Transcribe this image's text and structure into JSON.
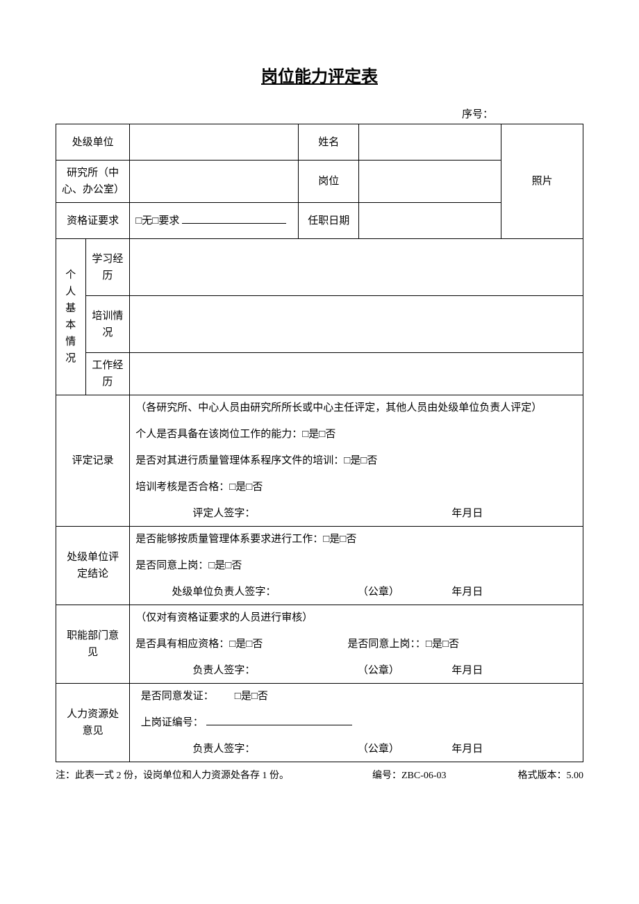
{
  "title": "岗位能力评定表",
  "seq_label": "序号：",
  "header": {
    "dept_label": "处级单位",
    "name_label": "姓名",
    "institute_label": "研究所（中心、办公室）",
    "position_label": "岗位",
    "cert_label": "资格证要求",
    "cert_value": "□无□要求 ",
    "start_date_label": "任职日期",
    "photo_label": "照片"
  },
  "basic": {
    "section_label": "个人基本情况",
    "edu_label": "学习经历",
    "train_label": "培训情况",
    "work_label": "工作经历"
  },
  "eval_record": {
    "label": "评定记录",
    "note": "（各研究所、中心人员由研究所所长或中心主任评定，其他人员由处级单位负责人评定）",
    "q1": "个人是否具备在该岗位工作的能力：□是□否",
    "q2": "是否对其进行质量管理体系程序文件的培训：□是□否",
    "q3": "培训考核是否合格：□是□否",
    "sig": "评定人签字：",
    "date": "年月日"
  },
  "dept_conclusion": {
    "label": "处级单位评定结论",
    "q1": "是否能够按质量管理体系要求进行工作：□是□否",
    "q2": "是否同意上岗：□是□否",
    "sig": "处级单位负责人签字：",
    "seal": "（公章）",
    "date": "年月日"
  },
  "func_opinion": {
    "label": "职能部门意见",
    "note": "（仅对有资格证要求的人员进行审核）",
    "q1": "是否具有相应资格：□是□否",
    "q2": "是否同意上岗：：□是□否",
    "sig": "负责人签字：",
    "seal": "（公章）",
    "date": "年月日"
  },
  "hr_opinion": {
    "label": "人力资源处意见",
    "q1_label": "是否同意发证：",
    "q1_opts": "□是□否",
    "q2_label": "上岗证编号：",
    "sig": "负责人签字：",
    "seal": "（公章）",
    "date": "年月日"
  },
  "footer": {
    "note": "注：此表一式 2 份，设岗单位和人力资源处各存 1 份。",
    "code": "编号：ZBC-06-03",
    "version": "格式版本：5.00"
  }
}
